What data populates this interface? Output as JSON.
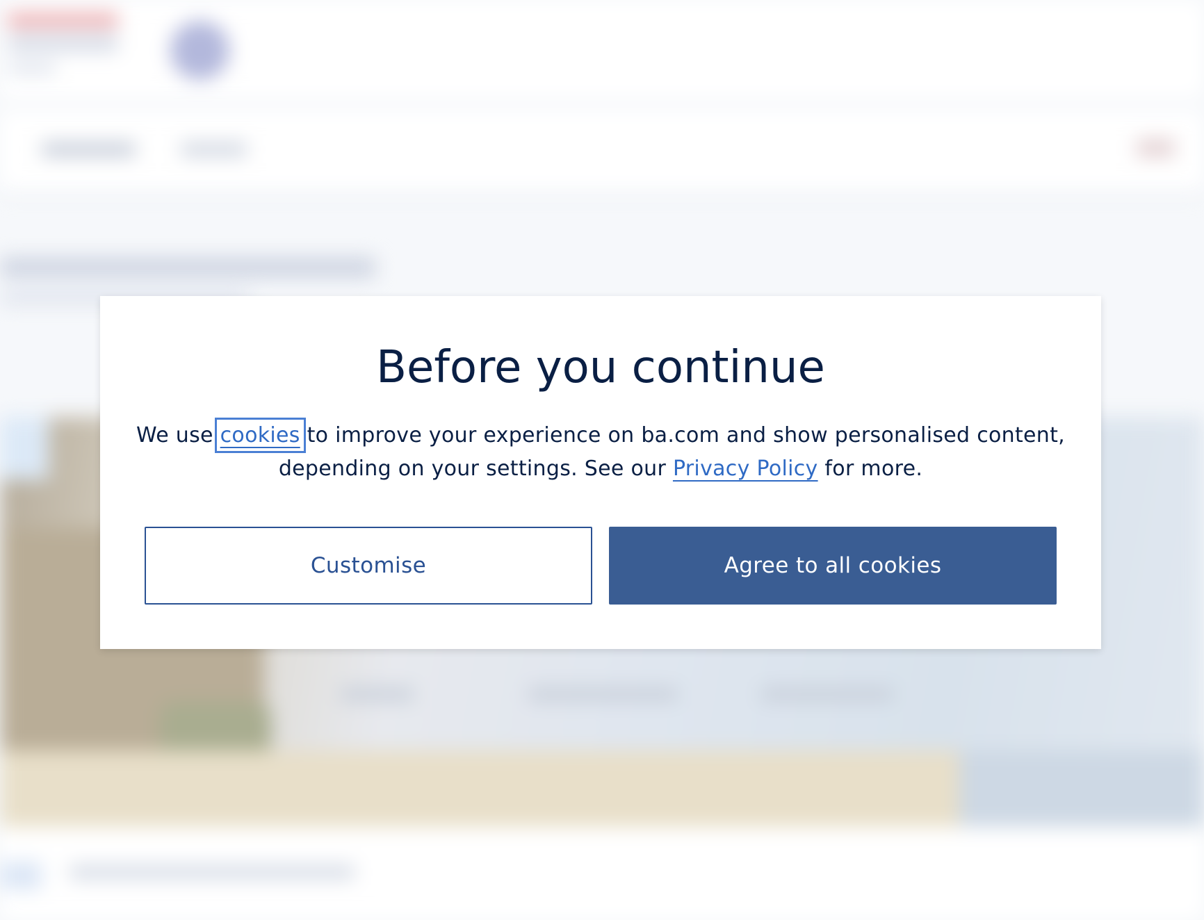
{
  "modal": {
    "title": "Before you continue",
    "text_before_cookies": "We use ",
    "cookies_link": "cookies",
    "text_middle": " to improve your experience on ba.com and show personalised content, depending on your settings. See our ",
    "privacy_link": "Privacy Policy",
    "text_after": " for more.",
    "customise_label": "Customise",
    "agree_label": "Agree to all cookies"
  },
  "colors": {
    "title_text": "#0a1f44",
    "link": "#2f6ac4",
    "primary_button": "#3a5d93",
    "secondary_button_border": "#2a5193"
  }
}
